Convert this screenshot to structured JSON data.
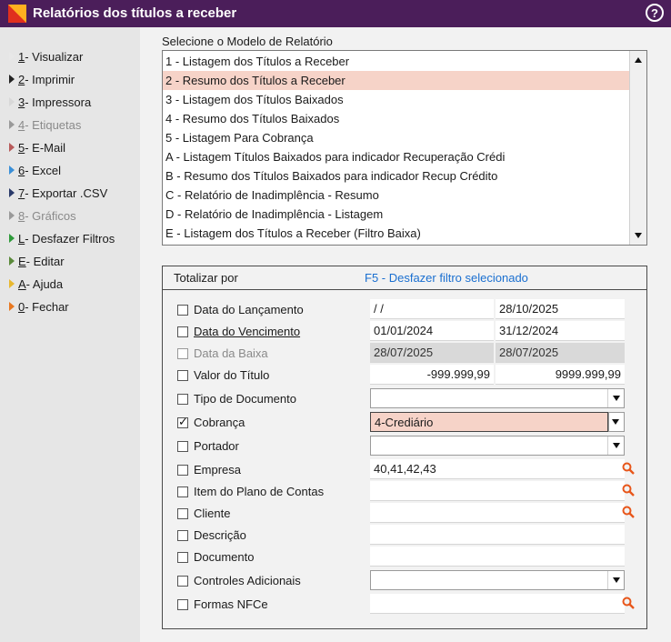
{
  "window": {
    "title": "Relatórios dos títulos a receber",
    "help_symbol": "?"
  },
  "sidebar": {
    "items": [
      {
        "key": "1",
        "label": " - Visualizar",
        "color": "#e8e8e8",
        "disabled": false
      },
      {
        "key": "2",
        "label": " - Imprimir",
        "color": "#222222",
        "disabled": false
      },
      {
        "key": "3",
        "label": " - Impressora",
        "color": "#d8d8d8",
        "disabled": false
      },
      {
        "key": "4",
        "label": " - Etiquetas",
        "color": "#9a9a9a",
        "disabled": true
      },
      {
        "key": "5",
        "label": " - E-Mail",
        "color": "#b85a5a",
        "disabled": false
      },
      {
        "key": "6",
        "label": " - Excel",
        "color": "#3a8fd8",
        "disabled": false
      },
      {
        "key": "7",
        "label": " - Exportar .CSV",
        "color": "#2a3a6a",
        "disabled": false
      },
      {
        "key": "8",
        "label": " - Gráficos",
        "color": "#9a9a9a",
        "disabled": true
      },
      {
        "key": "L",
        "label": " - Desfazer Filtros",
        "color": "#2e9a3a",
        "disabled": false
      },
      {
        "key": "E",
        "label": " - Editar",
        "color": "#5a8a3a",
        "disabled": false
      },
      {
        "key": "A",
        "label": " - Ajuda",
        "color": "#e8b830",
        "disabled": false
      },
      {
        "key": "0",
        "label": " - Fechar",
        "color": "#e87820",
        "disabled": false
      }
    ]
  },
  "report_list": {
    "label": "Selecione o Modelo de Relatório",
    "selected_index": 1,
    "items": [
      "1 - Listagem dos Títulos a Receber",
      "2 - Resumo dos Títulos a Receber",
      "3 - Listagem dos Títulos Baixados",
      "4 - Resumo dos Títulos Baixados",
      "5 - Listagem Para Cobrança",
      "A - Listagem Títulos Baixados para indicador Recuperação Crédi",
      "B - Resumo dos Títulos Baixados para indicador Recup Crédito",
      "C - Relatório de Inadimplência - Resumo",
      "D - Relatório de Inadimplência - Listagem",
      "E - Listagem dos Títulos a Receber (Filtro Baixa)"
    ]
  },
  "filters": {
    "totalizar_label": "Totalizar por",
    "f5_link": "F5 - Desfazer filtro selecionado",
    "rows": [
      {
        "label": "Data do Lançamento",
        "checked": false,
        "v1": " /  /",
        "v2": "28/10/2025"
      },
      {
        "label": "Data do Vencimento",
        "checked": false,
        "v1": "01/01/2024",
        "v2": "31/12/2024"
      },
      {
        "label": "Data da Baixa",
        "checked": false,
        "v1": "28/07/2025",
        "v2": "28/07/2025"
      },
      {
        "label": "Valor do Título",
        "checked": false,
        "v1": "-999.999,99",
        "v2": "9999.999,99"
      },
      {
        "label": "Tipo de Documento",
        "checked": false,
        "value": ""
      },
      {
        "label": "Cobrança",
        "checked": true,
        "value": "4-Crediário"
      },
      {
        "label": "Portador",
        "checked": false,
        "value": ""
      },
      {
        "label": "Empresa",
        "checked": false,
        "value": "40,41,42,43"
      },
      {
        "label": "Item do Plano de Contas",
        "checked": false,
        "value": ""
      },
      {
        "label": "Cliente",
        "checked": false,
        "value": ""
      },
      {
        "label": "Descrição",
        "checked": false,
        "value": ""
      },
      {
        "label": "Documento",
        "checked": false,
        "value": ""
      },
      {
        "label": "Controles Adicionais",
        "checked": false,
        "value": ""
      },
      {
        "label": "Formas NFCe",
        "checked": false,
        "value": ""
      }
    ]
  },
  "colors": {
    "title_bg": "#4b1e5a",
    "selection": "#f6d3c8",
    "link": "#1a6fd0",
    "search_icon": "#e8561a"
  }
}
